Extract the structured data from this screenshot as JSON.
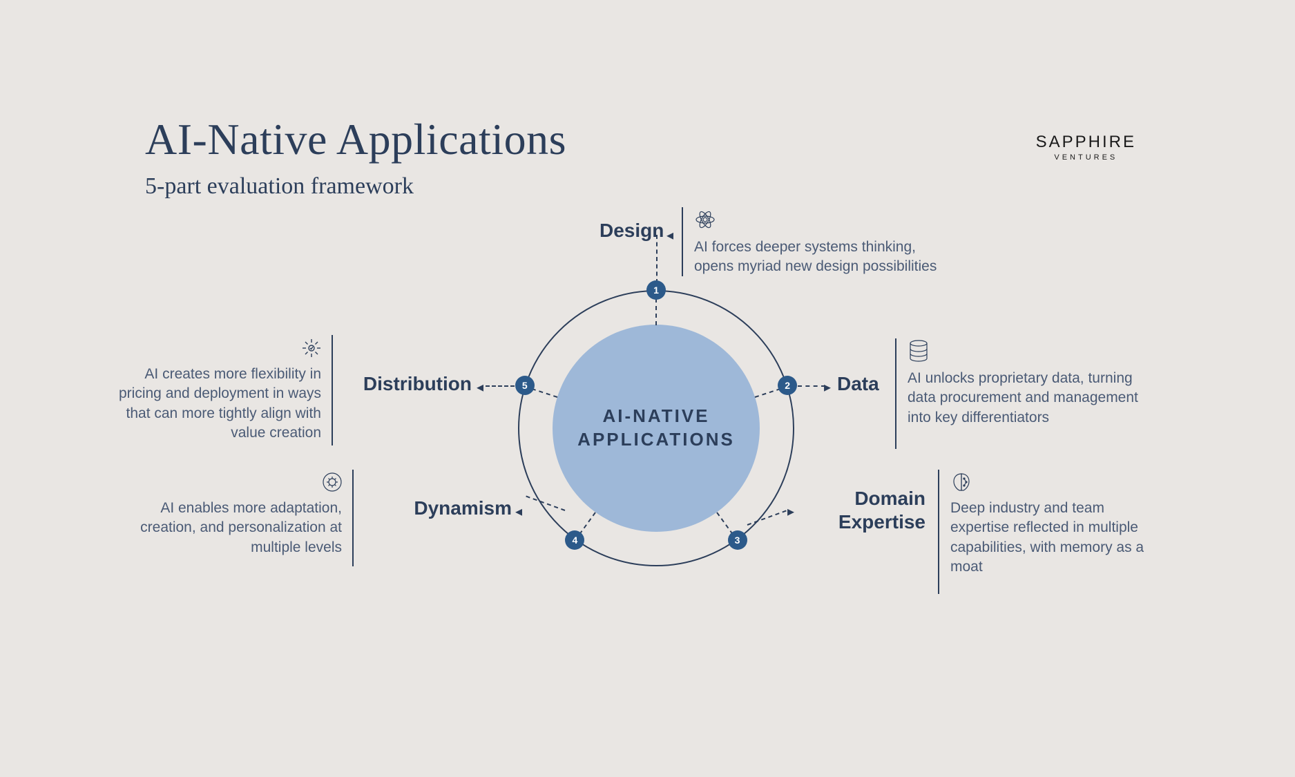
{
  "header": {
    "title": "AI-Native Applications",
    "subtitle": "5-part evaluation framework"
  },
  "logo": {
    "main": "SAPPHIRE",
    "sub": "VENTURES"
  },
  "center": {
    "line1": "AI-NATIVE",
    "line2": "APPLICATIONS"
  },
  "nodes": {
    "n1": "1",
    "n2": "2",
    "n3": "3",
    "n4": "4",
    "n5": "5"
  },
  "items": {
    "design": {
      "label": "Design",
      "desc": "AI forces deeper systems thinking, opens myriad new design possibilities"
    },
    "data": {
      "label": "Data",
      "desc": "AI unlocks proprietary data, turning data procurement and management into key differentiators"
    },
    "domain": {
      "label": "Domain Expertise",
      "desc": "Deep industry and team expertise reflected in multiple capabilities, with memory as a moat"
    },
    "dynamism": {
      "label": "Dynamism",
      "desc": "AI enables more adaptation, creation, and personalization at multiple levels"
    },
    "distribution": {
      "label": "Distribution",
      "desc": "AI creates more flexibility in pricing and deployment in ways that can more tightly align with value creation"
    }
  }
}
